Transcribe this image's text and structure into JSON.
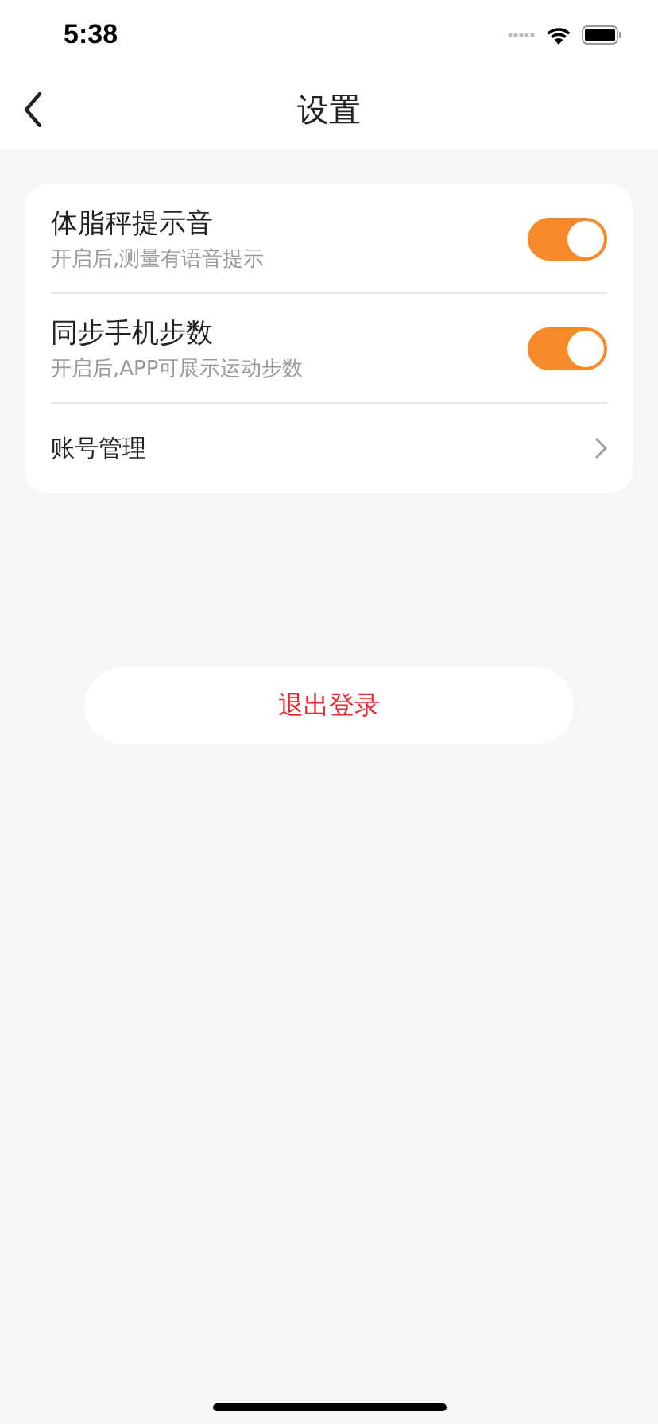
{
  "status_bar": {
    "time": "5:38"
  },
  "nav": {
    "title": "设置",
    "back": true
  },
  "settings": [
    {
      "kind": "toggle",
      "title": "体脂秤提示音",
      "subtitle": "开启后,测量有语音提示",
      "on": true
    },
    {
      "kind": "toggle",
      "title": "同步手机步数",
      "subtitle": "开启后,APP可展示运动步数",
      "on": true
    },
    {
      "kind": "link",
      "title": "账号管理"
    }
  ],
  "logout_button": "退出登录"
}
